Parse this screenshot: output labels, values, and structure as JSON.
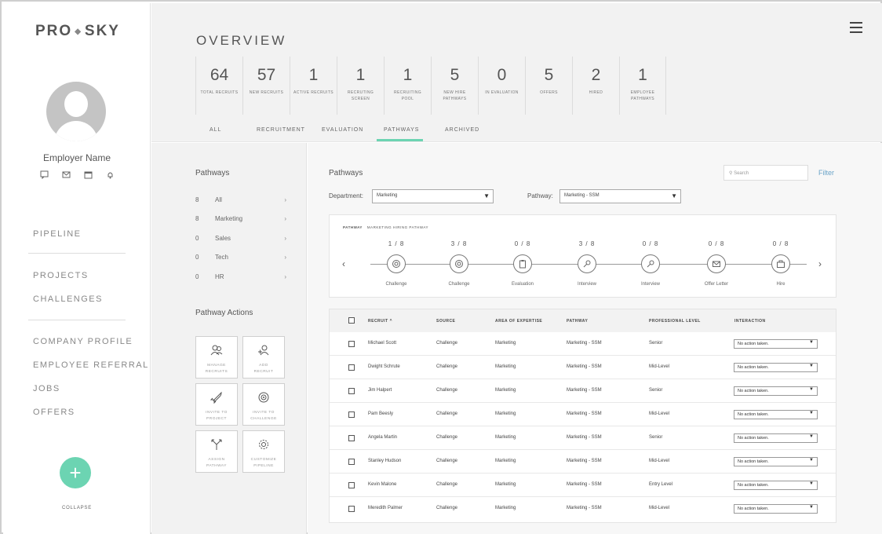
{
  "brand": {
    "logo_left": "PRO",
    "logo_right": "SKY"
  },
  "profile": {
    "name": "Employer Name"
  },
  "nav": {
    "pipeline": "PIPELINE",
    "projects": "PROJECTS",
    "challenges": "CHALLENGES",
    "company_profile": "COMPANY PROFILE",
    "employee_referral": "EMPLOYEE REFERRAL",
    "jobs": "JOBS",
    "offers": "OFFERS"
  },
  "fab": {
    "label": "+"
  },
  "collapse_label": "COLLAPSE",
  "overview": {
    "title": "OVERVIEW",
    "stats": [
      {
        "value": "64",
        "label": "TOTAL RECRUITS"
      },
      {
        "value": "57",
        "label": "NEW RECRUITS"
      },
      {
        "value": "1",
        "label": "ACTIVE RECRUITS"
      },
      {
        "value": "1",
        "label": "RECRUTING SCREEN"
      },
      {
        "value": "1",
        "label": "RECRUITING POOL"
      },
      {
        "value": "5",
        "label": "NEW HIRE PATHWAYS"
      },
      {
        "value": "0",
        "label": "IN EVALUATION"
      },
      {
        "value": "5",
        "label": "OFFERS"
      },
      {
        "value": "2",
        "label": "HIRED"
      },
      {
        "value": "1",
        "label": "EMPLOYEE PATHWAYS"
      }
    ],
    "tabs": [
      {
        "label": "ALL"
      },
      {
        "label": "RECRUITMENT"
      },
      {
        "label": "EVALUATION"
      },
      {
        "label": "PATHWAYS"
      },
      {
        "label": "ARCHIVED"
      }
    ],
    "active_tab": "PATHWAYS"
  },
  "left_panel": {
    "title": "Pathways",
    "items": [
      {
        "count": "8",
        "name": "All"
      },
      {
        "count": "8",
        "name": "Marketing"
      },
      {
        "count": "0",
        "name": "Sales"
      },
      {
        "count": "0",
        "name": "Tech"
      },
      {
        "count": "0",
        "name": "HR"
      }
    ],
    "actions_title": "Pathway Actions",
    "actions": [
      {
        "line1": "MANAGE",
        "line2": "RECRUITS"
      },
      {
        "line1": "ADD",
        "line2": "RECRUIT"
      },
      {
        "line1": "INVITE TO",
        "line2": "PROJECT"
      },
      {
        "line1": "INVITE TO",
        "line2": "CHALLENGE"
      },
      {
        "line1": "ASSIGN",
        "line2": "PATHWAY"
      },
      {
        "line1": "CUSTOMIZE",
        "line2": "PIPELINE"
      }
    ]
  },
  "main": {
    "title": "Pathways",
    "search_placeholder": "Search",
    "filter_label": "Filter",
    "department_label": "Department:",
    "department_value": "Marketing",
    "pathway_label": "Pathway:",
    "pathway_value": "Marketing - SSM",
    "pathway_box": {
      "label": "PATHWAY",
      "name": "MARKETING HIRING PATHWAY",
      "steps": [
        {
          "progress": "1 / 8",
          "label": "Challenge",
          "icon": "target-icon"
        },
        {
          "progress": "3 / 8",
          "label": "Challenge",
          "icon": "target-icon"
        },
        {
          "progress": "0 / 8",
          "label": "Evaluation",
          "icon": "clipboard-icon"
        },
        {
          "progress": "3 / 8",
          "label": "Interview",
          "icon": "microphone-icon"
        },
        {
          "progress": "0 / 8",
          "label": "Interview",
          "icon": "microphone-icon"
        },
        {
          "progress": "0 / 8",
          "label": "Offer Letter",
          "icon": "envelope-icon"
        },
        {
          "progress": "0 / 8",
          "label": "Hire",
          "icon": "briefcase-icon"
        }
      ]
    },
    "table": {
      "headers": {
        "recruit": "RECRUIT",
        "source": "SOURCE",
        "area": "AREA OF EXPERTISE",
        "pathway": "PATHWAY",
        "level": "PROFESSIONAL LEVEL",
        "interaction": "INTERACTION"
      },
      "rows": [
        {
          "recruit": "Michael Scott",
          "source": "Challenge",
          "area": "Marketing",
          "pathway": "Marketing - SSM",
          "level": "Senior",
          "interaction": "No action taken."
        },
        {
          "recruit": "Dwight Schrute",
          "source": "Challenge",
          "area": "Marketing",
          "pathway": "Marketing - SSM",
          "level": "Mid-Level",
          "interaction": "No action taken."
        },
        {
          "recruit": "Jim Halpert",
          "source": "Challenge",
          "area": "Marketing",
          "pathway": "Marketing - SSM",
          "level": "Senior",
          "interaction": "No action taken."
        },
        {
          "recruit": "Pam Beesly",
          "source": "Challenge",
          "area": "Marketing",
          "pathway": "Marketing - SSM",
          "level": "Mid-Level",
          "interaction": "No action taken."
        },
        {
          "recruit": "Angela Martin",
          "source": "Challenge",
          "area": "Marketing",
          "pathway": "Marketing - SSM",
          "level": "Senior",
          "interaction": "No action taken."
        },
        {
          "recruit": "Stanley Hudson",
          "source": "Challenge",
          "area": "Marketing",
          "pathway": "Marketing - SSM",
          "level": "Mid-Level",
          "interaction": "No action taken."
        },
        {
          "recruit": "Kevin Malone",
          "source": "Challenge",
          "area": "Marketing",
          "pathway": "Marketing - SSM",
          "level": "Entry Level",
          "interaction": "No action taken."
        },
        {
          "recruit": "Meredith Palmer",
          "source": "Challenge",
          "area": "Marketing",
          "pathway": "Marketing - SSM",
          "level": "Mid-Level",
          "interaction": "No action taken."
        }
      ]
    }
  },
  "colors": {
    "accent": "#6cd4b2",
    "link": "#6aa3c8"
  }
}
